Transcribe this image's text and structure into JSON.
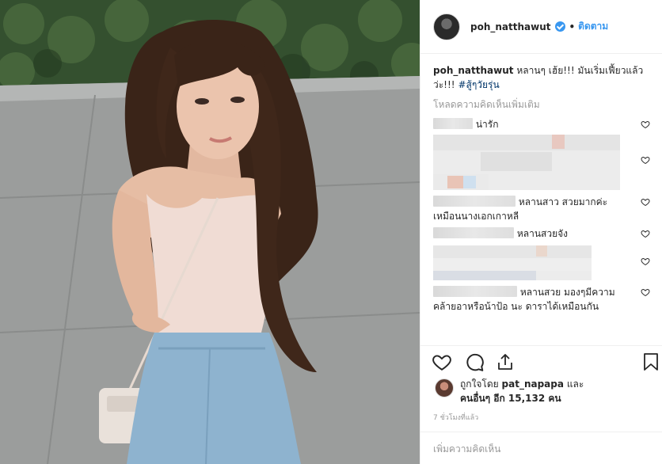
{
  "post": {
    "username": "poh_natthawut",
    "follow_label": "ติดตาม",
    "separator": "•"
  },
  "caption": {
    "username": "poh_natthawut",
    "text": "หลานๆ เฮ้ย!!! มันเริ่มเฟี้ยวแล้วว่ะ!!!",
    "hashtag": "#สู้ๆวัยรุ่น"
  },
  "load_more_comments": "โหลดความคิดเห็นเพิ่มเติม",
  "comments": [
    {
      "text": "น่ารัก"
    },
    {
      "text": ""
    },
    {
      "text": "หลานสาว สวยมากค่ะ เหมือนนางเอกเกาหลี"
    },
    {
      "text": "หลานสวยจัง"
    },
    {
      "text": ""
    },
    {
      "text": "หลานสวย มองๆมีความคล้ายอาหรือน้าป้อ นะ ดาราได้เหมือนกัน"
    }
  ],
  "likes": {
    "prefix": "ถูกใจโดย",
    "liker": "pat_napapa",
    "and": "และ",
    "others": "คนอื่นๆ อีก 15,132 คน"
  },
  "timestamp": "7 ชั่วโมงที่แล้ว",
  "add_comment_placeholder": "เพิ่มความคิดเห็น",
  "icons": [
    "verified-badge-icon",
    "heart-icon",
    "comment-icon",
    "share-icon",
    "bookmark-icon"
  ],
  "colors": {
    "link": "#3897f0",
    "hashtag": "#003569",
    "muted": "#999999",
    "border": "#efefef"
  }
}
